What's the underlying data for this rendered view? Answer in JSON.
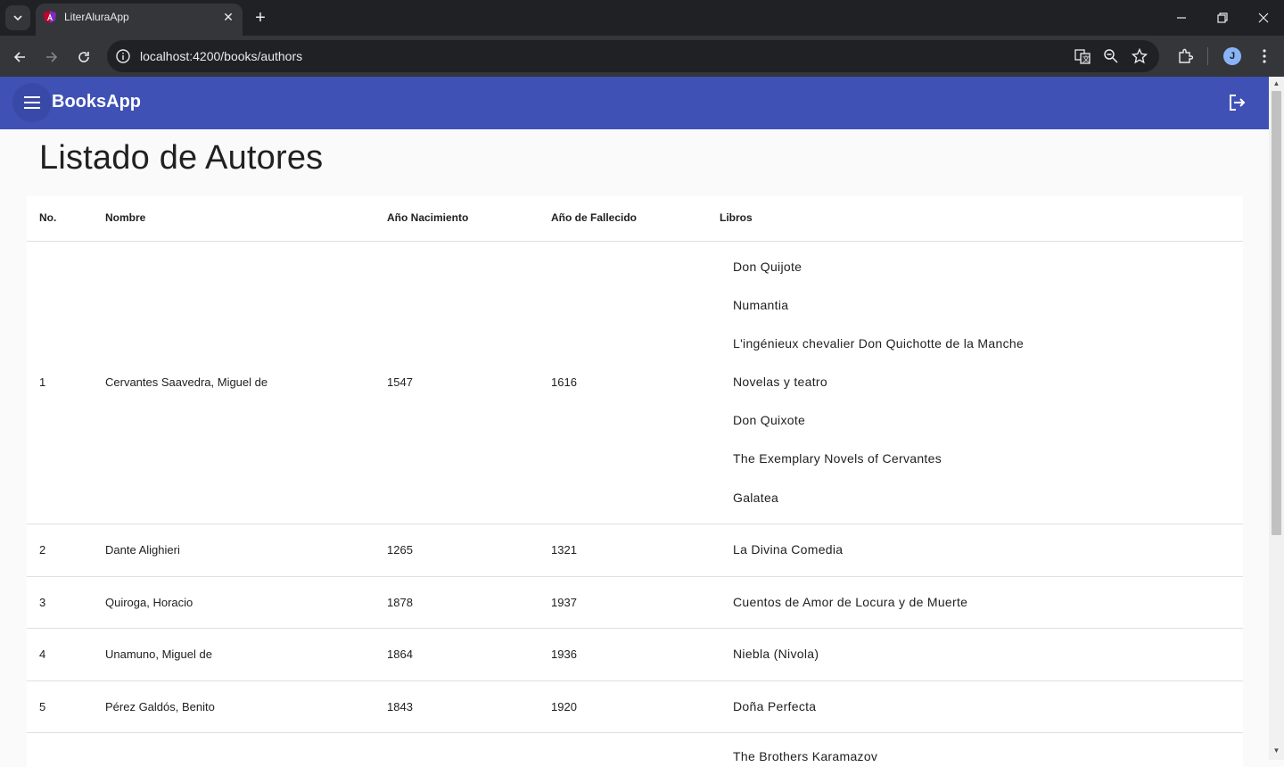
{
  "browser": {
    "tab_title": "LiterAluraApp",
    "url": "localhost:4200/books/authors",
    "profile_initial": "J"
  },
  "app": {
    "title": "BooksApp",
    "page_title": "Listado de Autores",
    "brand_color": "#3f51b5"
  },
  "table": {
    "headers": [
      "No.",
      "Nombre",
      "Año Nacimiento",
      "Año de Fallecido",
      "Libros"
    ],
    "rows": [
      {
        "no": "1",
        "name": "Cervantes Saavedra, Miguel de",
        "birth": "1547",
        "death": "1616",
        "books": [
          "Don Quijote",
          "Numantia",
          "L'ingénieux chevalier Don Quichotte de la Manche",
          "Novelas y teatro",
          "Don Quixote",
          "The Exemplary Novels of Cervantes",
          "Galatea"
        ]
      },
      {
        "no": "2",
        "name": "Dante Alighieri",
        "birth": "1265",
        "death": "1321",
        "books": [
          "La Divina Comedia"
        ]
      },
      {
        "no": "3",
        "name": "Quiroga, Horacio",
        "birth": "1878",
        "death": "1937",
        "books": [
          "Cuentos de Amor de Locura y de Muerte"
        ]
      },
      {
        "no": "4",
        "name": "Unamuno, Miguel de",
        "birth": "1864",
        "death": "1936",
        "books": [
          "Niebla (Nivola)"
        ]
      },
      {
        "no": "5",
        "name": "Pérez Galdós, Benito",
        "birth": "1843",
        "death": "1920",
        "books": [
          "Doña Perfecta"
        ]
      },
      {
        "no": "",
        "name": "",
        "birth": "",
        "death": "",
        "books": [
          "The Brothers Karamazov"
        ]
      }
    ]
  }
}
